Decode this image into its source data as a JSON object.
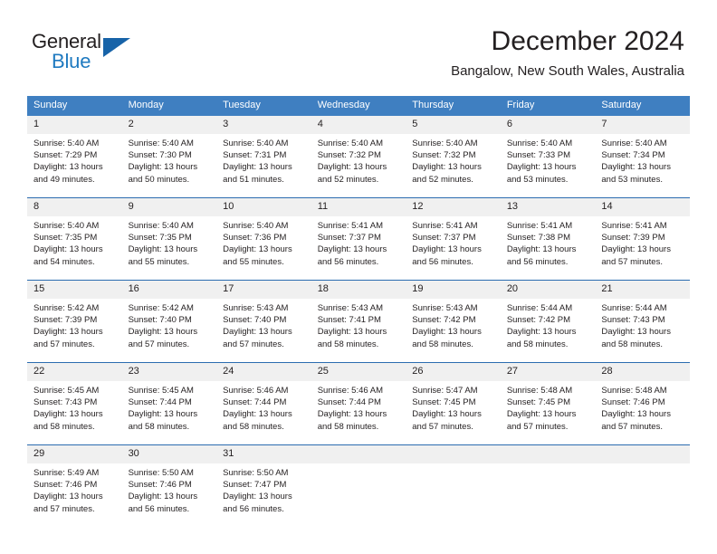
{
  "logo": {
    "line1": "General",
    "line2": "Blue",
    "icon": "triangle-flag-icon"
  },
  "header": {
    "month_title": "December 2024",
    "location": "Bangalow, New South Wales, Australia"
  },
  "colors": {
    "header_blue": "#3f7fc1",
    "row_divider_blue": "#2b6cb0",
    "daynum_band": "#f0f0f0",
    "logo_blue": "#1f7ac0",
    "text": "#231f20"
  },
  "calendar": {
    "weekday_headers": [
      "Sunday",
      "Monday",
      "Tuesday",
      "Wednesday",
      "Thursday",
      "Friday",
      "Saturday"
    ],
    "weeks": [
      [
        {
          "day": "1",
          "sunrise": "Sunrise: 5:40 AM",
          "sunset": "Sunset: 7:29 PM",
          "daylight1": "Daylight: 13 hours",
          "daylight2": "and 49 minutes."
        },
        {
          "day": "2",
          "sunrise": "Sunrise: 5:40 AM",
          "sunset": "Sunset: 7:30 PM",
          "daylight1": "Daylight: 13 hours",
          "daylight2": "and 50 minutes."
        },
        {
          "day": "3",
          "sunrise": "Sunrise: 5:40 AM",
          "sunset": "Sunset: 7:31 PM",
          "daylight1": "Daylight: 13 hours",
          "daylight2": "and 51 minutes."
        },
        {
          "day": "4",
          "sunrise": "Sunrise: 5:40 AM",
          "sunset": "Sunset: 7:32 PM",
          "daylight1": "Daylight: 13 hours",
          "daylight2": "and 52 minutes."
        },
        {
          "day": "5",
          "sunrise": "Sunrise: 5:40 AM",
          "sunset": "Sunset: 7:32 PM",
          "daylight1": "Daylight: 13 hours",
          "daylight2": "and 52 minutes."
        },
        {
          "day": "6",
          "sunrise": "Sunrise: 5:40 AM",
          "sunset": "Sunset: 7:33 PM",
          "daylight1": "Daylight: 13 hours",
          "daylight2": "and 53 minutes."
        },
        {
          "day": "7",
          "sunrise": "Sunrise: 5:40 AM",
          "sunset": "Sunset: 7:34 PM",
          "daylight1": "Daylight: 13 hours",
          "daylight2": "and 53 minutes."
        }
      ],
      [
        {
          "day": "8",
          "sunrise": "Sunrise: 5:40 AM",
          "sunset": "Sunset: 7:35 PM",
          "daylight1": "Daylight: 13 hours",
          "daylight2": "and 54 minutes."
        },
        {
          "day": "9",
          "sunrise": "Sunrise: 5:40 AM",
          "sunset": "Sunset: 7:35 PM",
          "daylight1": "Daylight: 13 hours",
          "daylight2": "and 55 minutes."
        },
        {
          "day": "10",
          "sunrise": "Sunrise: 5:40 AM",
          "sunset": "Sunset: 7:36 PM",
          "daylight1": "Daylight: 13 hours",
          "daylight2": "and 55 minutes."
        },
        {
          "day": "11",
          "sunrise": "Sunrise: 5:41 AM",
          "sunset": "Sunset: 7:37 PM",
          "daylight1": "Daylight: 13 hours",
          "daylight2": "and 56 minutes."
        },
        {
          "day": "12",
          "sunrise": "Sunrise: 5:41 AM",
          "sunset": "Sunset: 7:37 PM",
          "daylight1": "Daylight: 13 hours",
          "daylight2": "and 56 minutes."
        },
        {
          "day": "13",
          "sunrise": "Sunrise: 5:41 AM",
          "sunset": "Sunset: 7:38 PM",
          "daylight1": "Daylight: 13 hours",
          "daylight2": "and 56 minutes."
        },
        {
          "day": "14",
          "sunrise": "Sunrise: 5:41 AM",
          "sunset": "Sunset: 7:39 PM",
          "daylight1": "Daylight: 13 hours",
          "daylight2": "and 57 minutes."
        }
      ],
      [
        {
          "day": "15",
          "sunrise": "Sunrise: 5:42 AM",
          "sunset": "Sunset: 7:39 PM",
          "daylight1": "Daylight: 13 hours",
          "daylight2": "and 57 minutes."
        },
        {
          "day": "16",
          "sunrise": "Sunrise: 5:42 AM",
          "sunset": "Sunset: 7:40 PM",
          "daylight1": "Daylight: 13 hours",
          "daylight2": "and 57 minutes."
        },
        {
          "day": "17",
          "sunrise": "Sunrise: 5:43 AM",
          "sunset": "Sunset: 7:40 PM",
          "daylight1": "Daylight: 13 hours",
          "daylight2": "and 57 minutes."
        },
        {
          "day": "18",
          "sunrise": "Sunrise: 5:43 AM",
          "sunset": "Sunset: 7:41 PM",
          "daylight1": "Daylight: 13 hours",
          "daylight2": "and 58 minutes."
        },
        {
          "day": "19",
          "sunrise": "Sunrise: 5:43 AM",
          "sunset": "Sunset: 7:42 PM",
          "daylight1": "Daylight: 13 hours",
          "daylight2": "and 58 minutes."
        },
        {
          "day": "20",
          "sunrise": "Sunrise: 5:44 AM",
          "sunset": "Sunset: 7:42 PM",
          "daylight1": "Daylight: 13 hours",
          "daylight2": "and 58 minutes."
        },
        {
          "day": "21",
          "sunrise": "Sunrise: 5:44 AM",
          "sunset": "Sunset: 7:43 PM",
          "daylight1": "Daylight: 13 hours",
          "daylight2": "and 58 minutes."
        }
      ],
      [
        {
          "day": "22",
          "sunrise": "Sunrise: 5:45 AM",
          "sunset": "Sunset: 7:43 PM",
          "daylight1": "Daylight: 13 hours",
          "daylight2": "and 58 minutes."
        },
        {
          "day": "23",
          "sunrise": "Sunrise: 5:45 AM",
          "sunset": "Sunset: 7:44 PM",
          "daylight1": "Daylight: 13 hours",
          "daylight2": "and 58 minutes."
        },
        {
          "day": "24",
          "sunrise": "Sunrise: 5:46 AM",
          "sunset": "Sunset: 7:44 PM",
          "daylight1": "Daylight: 13 hours",
          "daylight2": "and 58 minutes."
        },
        {
          "day": "25",
          "sunrise": "Sunrise: 5:46 AM",
          "sunset": "Sunset: 7:44 PM",
          "daylight1": "Daylight: 13 hours",
          "daylight2": "and 58 minutes."
        },
        {
          "day": "26",
          "sunrise": "Sunrise: 5:47 AM",
          "sunset": "Sunset: 7:45 PM",
          "daylight1": "Daylight: 13 hours",
          "daylight2": "and 57 minutes."
        },
        {
          "day": "27",
          "sunrise": "Sunrise: 5:48 AM",
          "sunset": "Sunset: 7:45 PM",
          "daylight1": "Daylight: 13 hours",
          "daylight2": "and 57 minutes."
        },
        {
          "day": "28",
          "sunrise": "Sunrise: 5:48 AM",
          "sunset": "Sunset: 7:46 PM",
          "daylight1": "Daylight: 13 hours",
          "daylight2": "and 57 minutes."
        }
      ],
      [
        {
          "day": "29",
          "sunrise": "Sunrise: 5:49 AM",
          "sunset": "Sunset: 7:46 PM",
          "daylight1": "Daylight: 13 hours",
          "daylight2": "and 57 minutes."
        },
        {
          "day": "30",
          "sunrise": "Sunrise: 5:50 AM",
          "sunset": "Sunset: 7:46 PM",
          "daylight1": "Daylight: 13 hours",
          "daylight2": "and 56 minutes."
        },
        {
          "day": "31",
          "sunrise": "Sunrise: 5:50 AM",
          "sunset": "Sunset: 7:47 PM",
          "daylight1": "Daylight: 13 hours",
          "daylight2": "and 56 minutes."
        },
        {
          "day": "",
          "sunrise": "",
          "sunset": "",
          "daylight1": "",
          "daylight2": ""
        },
        {
          "day": "",
          "sunrise": "",
          "sunset": "",
          "daylight1": "",
          "daylight2": ""
        },
        {
          "day": "",
          "sunrise": "",
          "sunset": "",
          "daylight1": "",
          "daylight2": ""
        },
        {
          "day": "",
          "sunrise": "",
          "sunset": "",
          "daylight1": "",
          "daylight2": ""
        }
      ]
    ]
  }
}
